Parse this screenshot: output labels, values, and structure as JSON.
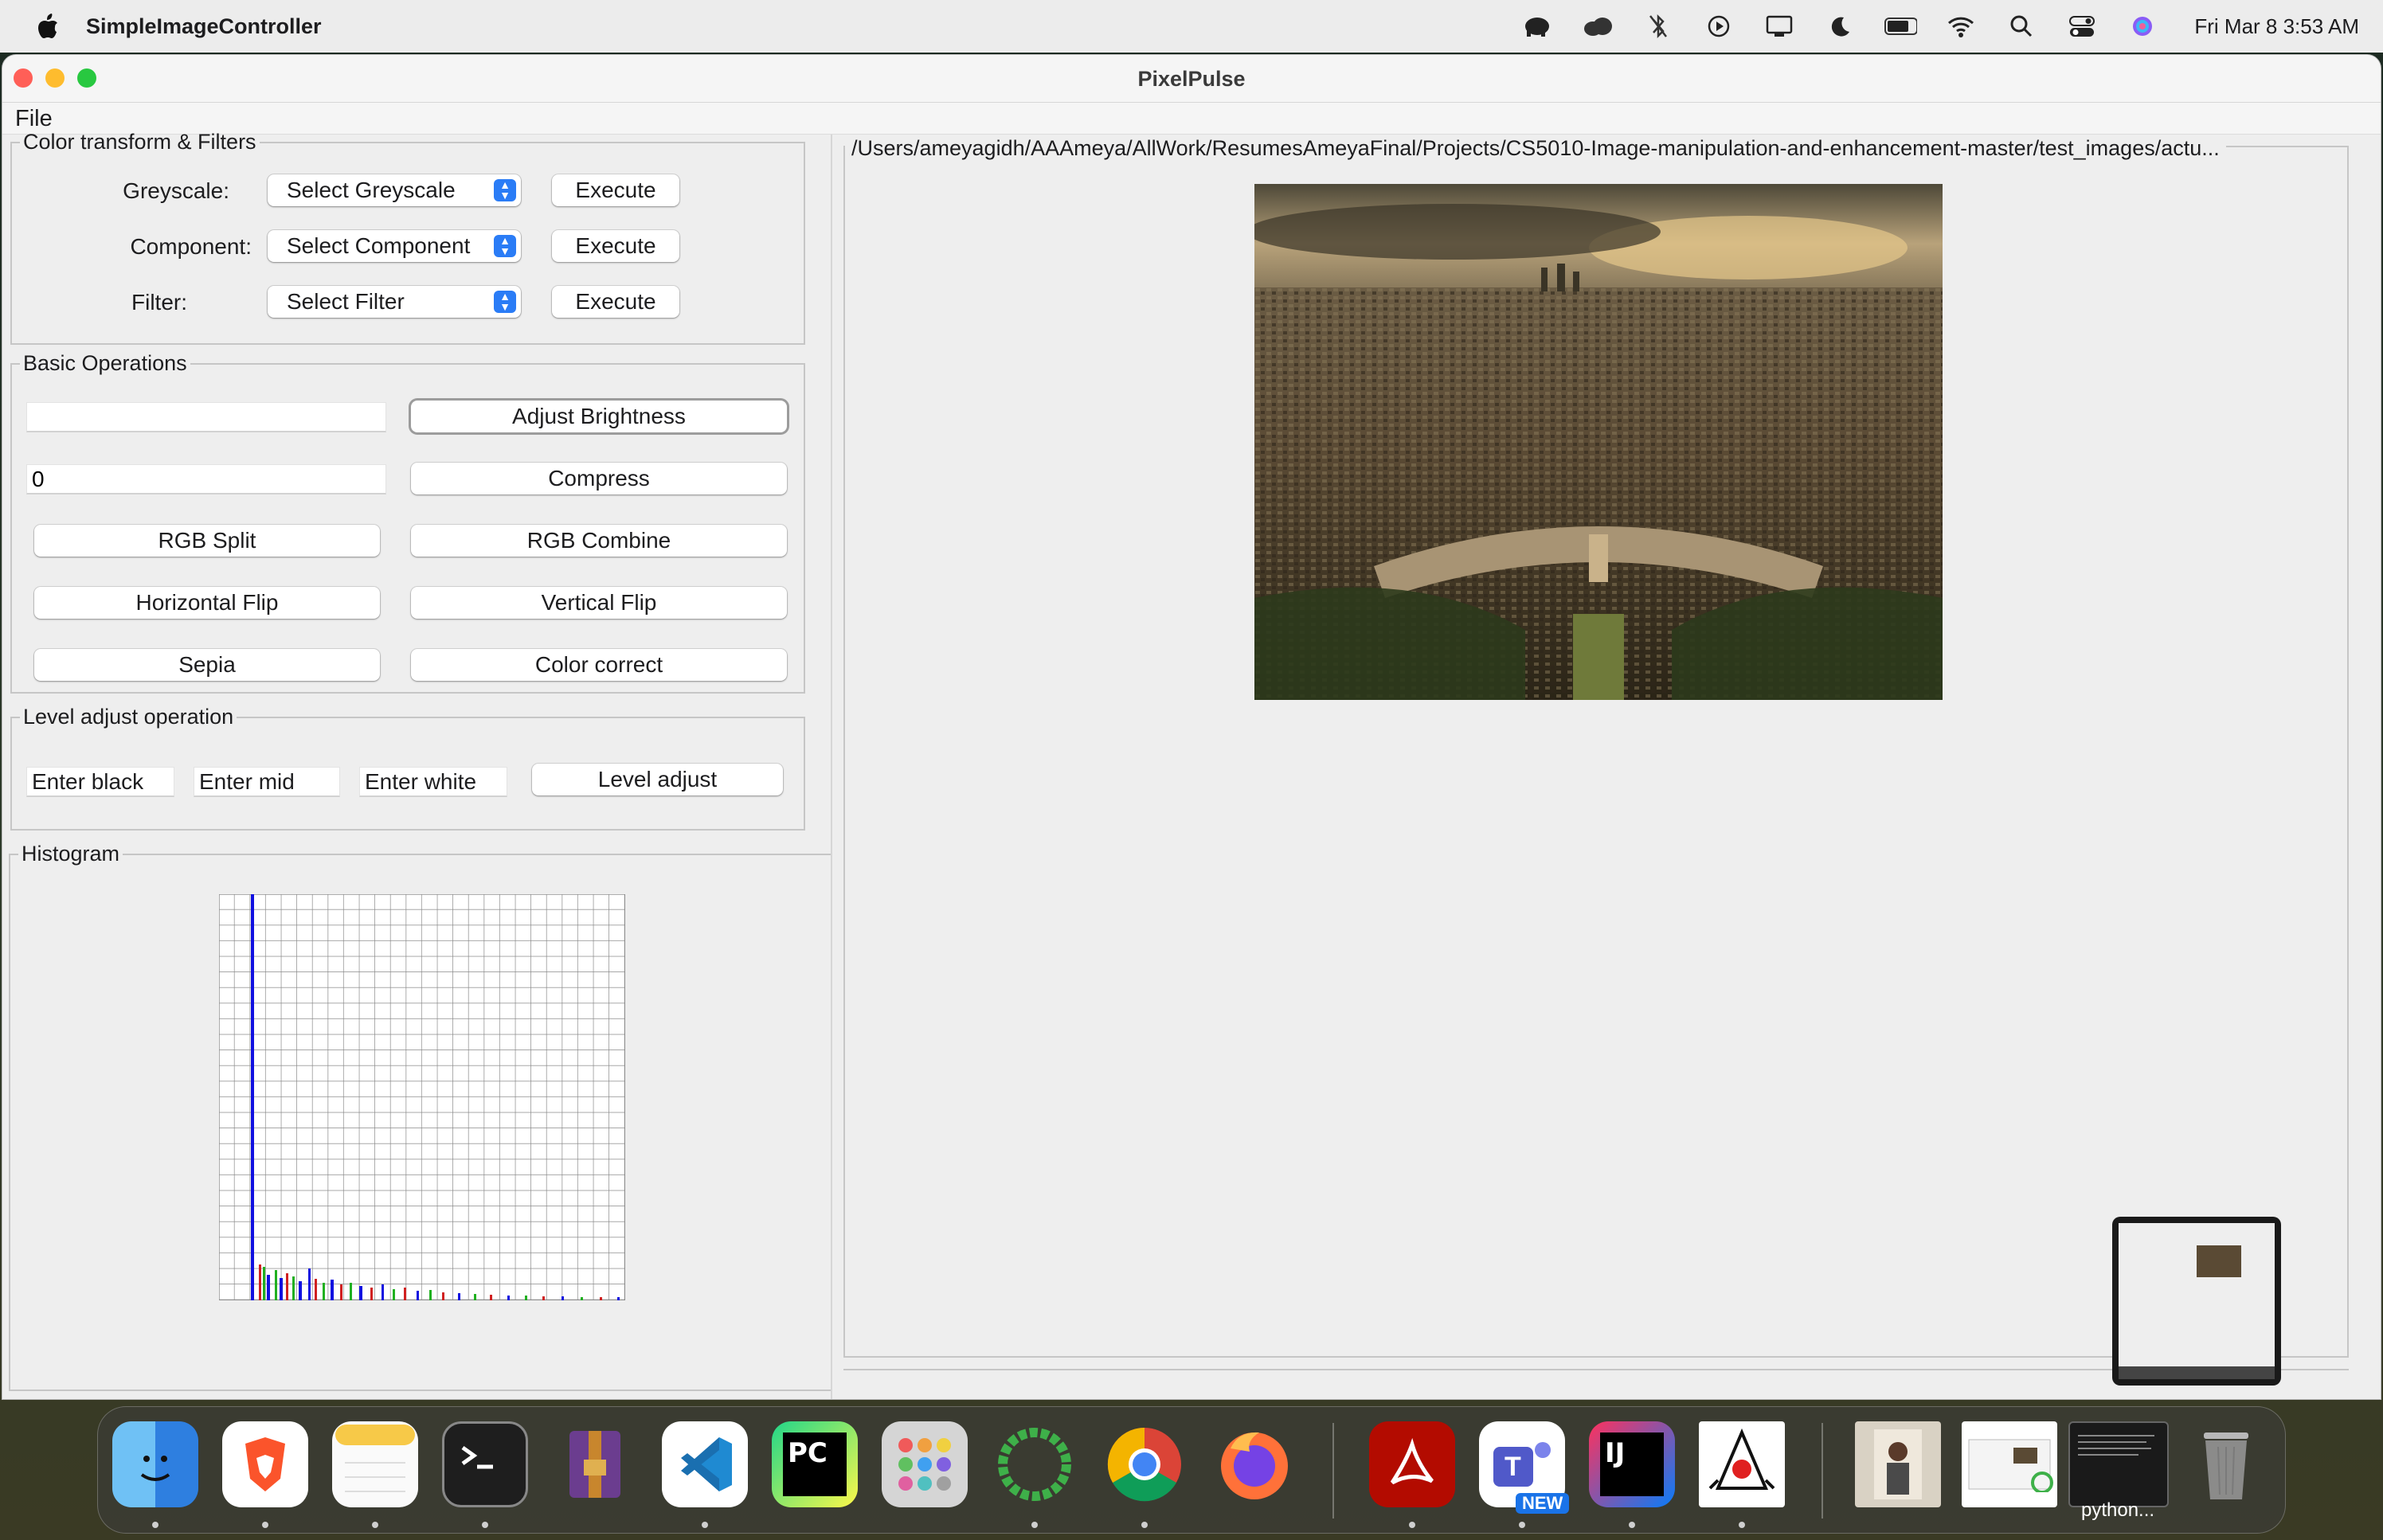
{
  "menubar": {
    "app_name": "SimpleImageController",
    "datetime": "Fri Mar 8  3:53 AM",
    "icons": [
      "elephant-icon",
      "cloud-icon",
      "bluetooth-off-icon",
      "play-circle-icon",
      "display-icon",
      "moon-icon",
      "battery-icon",
      "wifi-icon",
      "search-icon",
      "control-center-icon",
      "siri-icon"
    ]
  },
  "window": {
    "title": "PixelPulse",
    "menu_file": "File"
  },
  "color_group": {
    "legend": "Color transform & Filters",
    "greyscale_label": "Greyscale:",
    "greyscale_select": "Select Greyscale",
    "component_label": "Component:",
    "component_select": "Select Component",
    "filter_label": "Filter:",
    "filter_select": "Select Filter",
    "execute_label": "Execute"
  },
  "basic_group": {
    "legend": "Basic Operations",
    "brightness_value": "",
    "compress_value": "0",
    "adjust_brightness": "Adjust Brightness",
    "compress": "Compress",
    "rgb_split": "RGB Split",
    "rgb_combine": "RGB Combine",
    "horizontal_flip": "Horizontal Flip",
    "vertical_flip": "Vertical Flip",
    "sepia": "Sepia",
    "color_correct": "Color correct"
  },
  "level_group": {
    "legend": "Level adjust operation",
    "black_placeholder": "Enter black",
    "mid_placeholder": "Enter mid",
    "white_placeholder": "Enter white",
    "level_adjust": "Level adjust"
  },
  "histogram": {
    "legend": "Histogram"
  },
  "image_panel": {
    "path": "/Users/ameyagidh/AAAmeya/AllWork/ResumesAmeyaFinal/Projects/CS5010-Image-manipulation-and-enhancement-master/test_images/actu..."
  },
  "dock": {
    "apps": [
      "Finder",
      "Brave",
      "Notes",
      "Terminal",
      "RAR Extractor",
      "VS Code",
      "PyCharm",
      "Launchpad",
      "Anaconda",
      "Chrome",
      "Firefox",
      "Acrobat",
      "Teams",
      "IntelliJ IDEA",
      "Java"
    ],
    "teams_badge": "NEW",
    "python_label": "python..."
  },
  "colors": {
    "accent": "#2a7cf6",
    "close": "#ff5f57",
    "minimize": "#febc2e",
    "zoom": "#28c840"
  }
}
